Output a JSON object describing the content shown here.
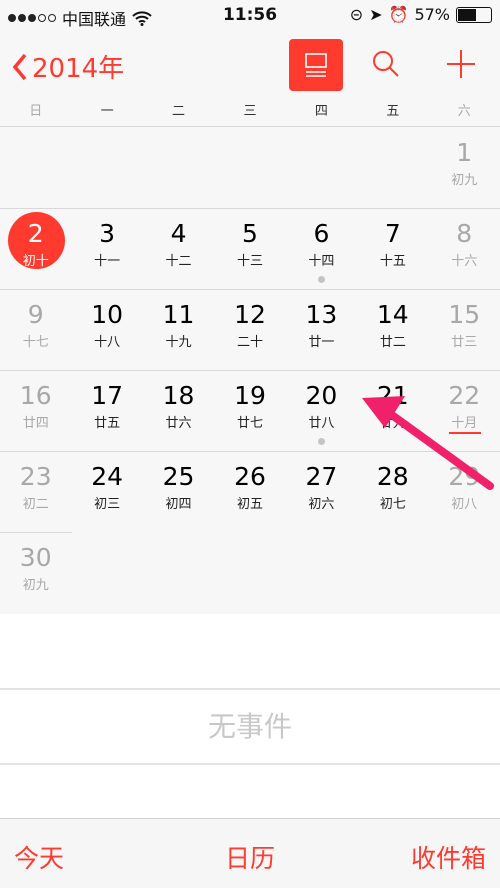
{
  "status_bar": {
    "carrier": "中国联通",
    "time": "11:56",
    "battery": "57%",
    "battery_level": 0.57,
    "signal_bars": 3
  },
  "header": {
    "back_label": "2014年",
    "icons": [
      "chevron-left-icon",
      "list-view-icon",
      "search-icon",
      "plus-icon"
    ]
  },
  "weekdays": [
    "日",
    "一",
    "二",
    "三",
    "四",
    "五",
    "六"
  ],
  "weeks": [
    [
      null,
      null,
      null,
      null,
      null,
      null,
      {
        "day": "1",
        "lunar": "初九",
        "m": true
      }
    ],
    [
      {
        "day": "2",
        "lunar": "初十",
        "m": true,
        "today": true
      },
      {
        "day": "3",
        "lunar": "十一"
      },
      {
        "day": "4",
        "lunar": "十二"
      },
      {
        "day": "5",
        "lunar": "十三"
      },
      {
        "day": "6",
        "lunar": "十四",
        "dot": true
      },
      {
        "day": "7",
        "lunar": "十五"
      },
      {
        "day": "8",
        "lunar": "十六",
        "m": true
      }
    ],
    [
      {
        "day": "9",
        "lunar": "十七",
        "m": true
      },
      {
        "day": "10",
        "lunar": "十八"
      },
      {
        "day": "11",
        "lunar": "十九"
      },
      {
        "day": "12",
        "lunar": "二十"
      },
      {
        "day": "13",
        "lunar": "廿一"
      },
      {
        "day": "14",
        "lunar": "廿二"
      },
      {
        "day": "15",
        "lunar": "廿三",
        "m": true
      }
    ],
    [
      {
        "day": "16",
        "lunar": "廿四",
        "m": true
      },
      {
        "day": "17",
        "lunar": "廿五"
      },
      {
        "day": "18",
        "lunar": "廿六"
      },
      {
        "day": "19",
        "lunar": "廿七"
      },
      {
        "day": "20",
        "lunar": "廿八",
        "dot": true
      },
      {
        "day": "21",
        "lunar": "廿九"
      },
      {
        "day": "22",
        "lunar": "十月",
        "m": true,
        "underline": true
      }
    ],
    [
      {
        "day": "23",
        "lunar": "初二",
        "m": true
      },
      {
        "day": "24",
        "lunar": "初三"
      },
      {
        "day": "25",
        "lunar": "初四"
      },
      {
        "day": "26",
        "lunar": "初五"
      },
      {
        "day": "27",
        "lunar": "初六"
      },
      {
        "day": "28",
        "lunar": "初七"
      },
      {
        "day": "29",
        "lunar": "初八",
        "m": true
      }
    ],
    [
      {
        "day": "30",
        "lunar": "初九",
        "m": true
      },
      null,
      null,
      null,
      null,
      null,
      null
    ]
  ],
  "events": {
    "empty_text": "无事件"
  },
  "toolbar": {
    "today": "今天",
    "calendars": "日历",
    "inbox": "收件箱"
  },
  "colors": {
    "accent": "#ff3b30",
    "annotation_arrow": "#f0206a"
  }
}
